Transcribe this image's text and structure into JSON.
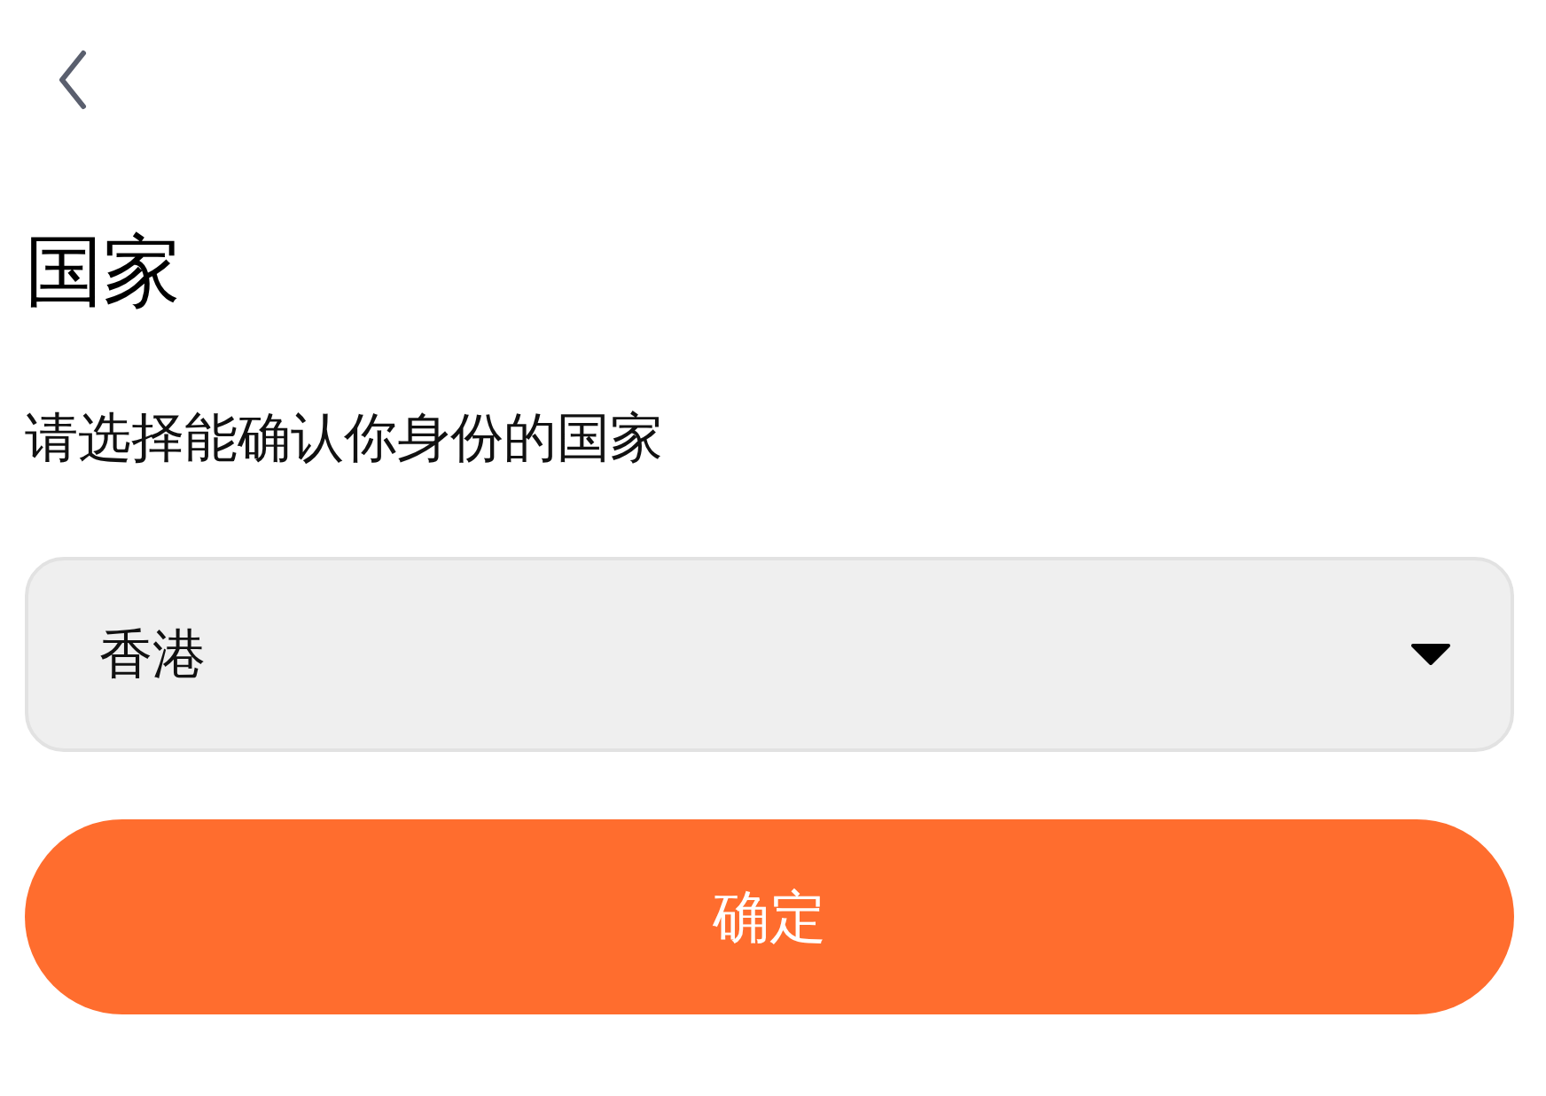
{
  "title": "国家",
  "subtitle": "请选择能确认你身份的国家",
  "country_select": {
    "value": "香港"
  },
  "confirm_button": {
    "label": "确定"
  }
}
